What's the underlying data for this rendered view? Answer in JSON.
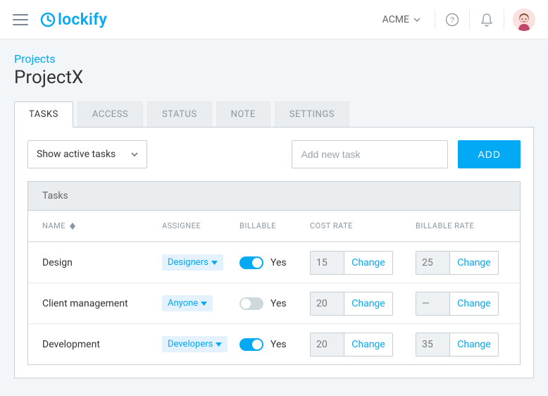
{
  "header": {
    "logo_text": "lockify",
    "workspace": "ACME"
  },
  "breadcrumb": "Projects",
  "page_title": "ProjectX",
  "tabs": [
    {
      "label": "TASKS",
      "active": true
    },
    {
      "label": "ACCESS",
      "active": false
    },
    {
      "label": "STATUS",
      "active": false
    },
    {
      "label": "NOTE",
      "active": false
    },
    {
      "label": "SETTINGS",
      "active": false
    }
  ],
  "filter": {
    "selected": "Show active tasks"
  },
  "add_task": {
    "placeholder": "Add new task",
    "button": "ADD"
  },
  "table": {
    "caption": "Tasks",
    "columns": {
      "name": "NAME",
      "assignee": "ASSIGNEE",
      "billable": "BILLABLE",
      "cost_rate": "COST RATE",
      "billable_rate": "BILLABLE RATE"
    },
    "billable_label": "Yes",
    "change_label": "Change",
    "rows": [
      {
        "name": "Design",
        "assignee": "Designers",
        "billable": true,
        "cost_rate": "15",
        "billable_rate": "25"
      },
      {
        "name": "Client management",
        "assignee": "Anyone",
        "billable": false,
        "cost_rate": "20",
        "billable_rate": "—"
      },
      {
        "name": "Development",
        "assignee": "Developers",
        "billable": true,
        "cost_rate": "20",
        "billable_rate": "35"
      }
    ]
  }
}
